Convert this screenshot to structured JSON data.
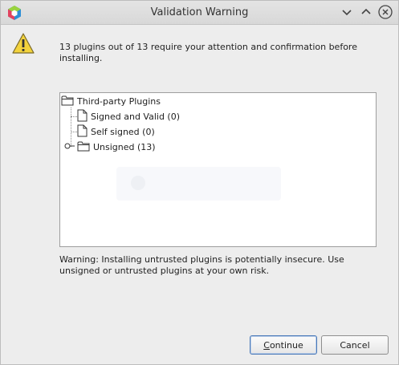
{
  "window": {
    "title": "Validation Warning",
    "controls": [
      "minimize",
      "maximize",
      "close"
    ]
  },
  "message": {
    "text": "13 plugins out of 13 require your attention and confirmation before installing."
  },
  "tree": {
    "root": {
      "label": "Third-party Plugins",
      "icon": "folder-open-icon"
    },
    "children": [
      {
        "label": "Signed and Valid (0)",
        "icon": "document-icon",
        "expandable": false
      },
      {
        "label": "Self signed (0)",
        "icon": "document-icon",
        "expandable": false
      },
      {
        "label": "Unsigned (13)",
        "icon": "folder-icon",
        "expandable": true
      }
    ]
  },
  "warning": {
    "text": "Warning: Installing untrusted plugins is potentially insecure. Use unsigned or untrusted plugins at your own risk."
  },
  "buttons": {
    "continue_rest": "ontinue",
    "continue_mnemonic": "C",
    "cancel_label": "Cancel"
  },
  "colors": {
    "warning_yellow": "#f3d33d",
    "tree_background": "#ffffff",
    "dialog_background": "#ededed"
  }
}
